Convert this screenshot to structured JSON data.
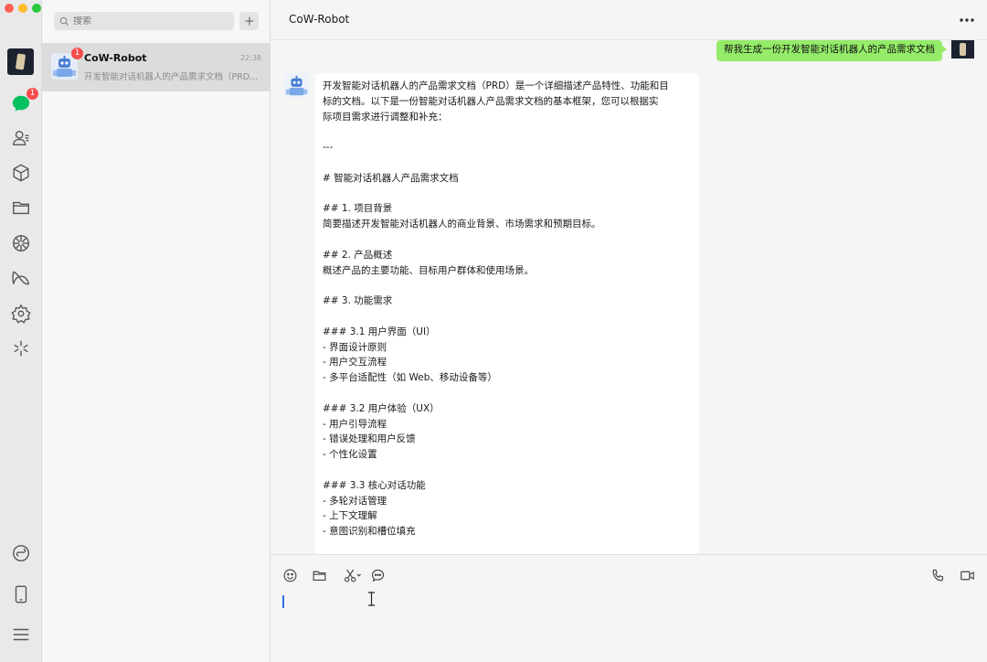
{
  "window": {
    "traffic_lights": [
      "#fe5f57",
      "#febc2e",
      "#28c840"
    ]
  },
  "rail": {
    "chat_badge": "1",
    "icons": [
      "chat-icon",
      "contacts-icon",
      "favorites-box-icon",
      "folder-icon",
      "moments-icon",
      "channels-icon",
      "mini-programs-icon",
      "search-sparkle-icon",
      "mini-program-link-icon",
      "phone-icon",
      "menu-icon"
    ]
  },
  "list": {
    "search_placeholder": "搜索",
    "conversation": {
      "name": "CoW-Robot",
      "time": "22:38",
      "badge": "1",
      "preview": "开发智能对话机器人的产品需求文档（PRD..."
    }
  },
  "chat": {
    "title": "CoW-Robot",
    "user_message": "帮我生成一份开发智能对话机器人的产品需求文档",
    "bot_lines": [
      "开发智能对话机器人的产品需求文档（PRD）是一个详细描述产品特性、功能和目",
      "标的文档。以下是一份智能对话机器人产品需求文档的基本框架，您可以根据实",
      "际项目需求进行调整和补充：",
      "",
      "---",
      "",
      "# 智能对话机器人产品需求文档",
      "",
      "## 1. 项目背景",
      "简要描述开发智能对话机器人的商业背景、市场需求和预期目标。",
      "",
      "## 2. 产品概述",
      "概述产品的主要功能、目标用户群体和使用场景。",
      "",
      "## 3. 功能需求",
      "",
      "### 3.1 用户界面（UI）",
      "- 界面设计原则",
      "- 用户交互流程",
      "- 多平台适配性（如 Web、移动设备等）",
      "",
      "### 3.2 用户体验（UX）",
      "- 用户引导流程",
      "- 错误处理和用户反馈",
      "- 个性化设置",
      "",
      "### 3.3 核心对话功能",
      "- 多轮对话管理",
      "- 上下文理解",
      "- 意图识别和槽位填充"
    ],
    "user_bubble_color": "#95ec69",
    "input_value": ""
  }
}
